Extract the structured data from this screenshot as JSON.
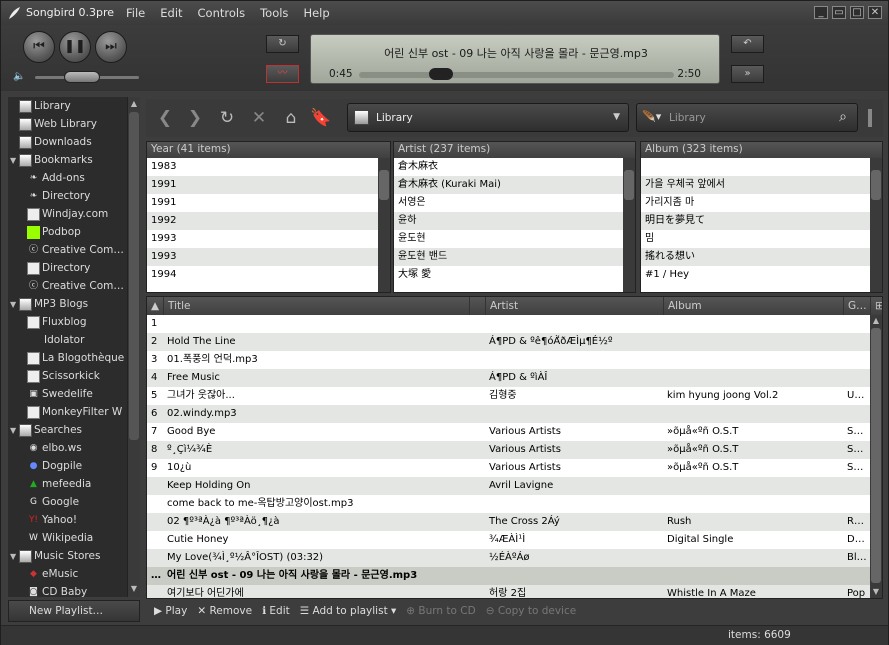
{
  "window": {
    "title": "Songbird 0.3pre",
    "controls": [
      "_",
      "▭",
      "□",
      "✕"
    ]
  },
  "menu": [
    "File",
    "Edit",
    "Controls",
    "Tools",
    "Help"
  ],
  "player": {
    "now_playing": "어린 신부 ost - 09 나는 아직 사랑을 몰라 - 문근영.mp3",
    "elapsed": "0:45",
    "total": "2:50",
    "progress": 0.26,
    "volume": 0.45,
    "prev_icon": "prev-icon",
    "pause_icon": "pause-icon",
    "next_icon": "next-icon",
    "repeat_icon": "repeat-icon",
    "shuffle_icon": "shuffle-icon",
    "back_icon": "back-icon",
    "forward_icon": "forward-icon"
  },
  "sidebar": {
    "items": [
      {
        "label": "Library",
        "level": 0,
        "icon": "library-icon",
        "twisty": ""
      },
      {
        "label": "Web Library",
        "level": 0,
        "icon": "library-icon",
        "twisty": ""
      },
      {
        "label": "Downloads",
        "level": 0,
        "icon": "download-icon",
        "twisty": ""
      },
      {
        "label": "Bookmarks",
        "level": 0,
        "icon": "bookmarks-icon",
        "twisty": "▼"
      },
      {
        "label": "Add-ons",
        "level": 1,
        "icon": "feather-icon",
        "twisty": ""
      },
      {
        "label": "Directory",
        "level": 1,
        "icon": "feather-icon",
        "twisty": ""
      },
      {
        "label": "Windjay.com",
        "level": 1,
        "icon": "page-icon",
        "twisty": ""
      },
      {
        "label": "Podbop",
        "level": 1,
        "icon": "podbop-icon",
        "twisty": ""
      },
      {
        "label": "Creative Com…",
        "level": 1,
        "icon": "cc-icon",
        "twisty": ""
      },
      {
        "label": "Directory",
        "level": 1,
        "icon": "page-icon",
        "twisty": ""
      },
      {
        "label": "Creative Com…",
        "level": 1,
        "icon": "cc-icon",
        "twisty": ""
      },
      {
        "label": "MP3 Blogs",
        "level": 0,
        "icon": "library-icon",
        "twisty": "▼"
      },
      {
        "label": "Fluxblog",
        "level": 1,
        "icon": "page-icon",
        "twisty": ""
      },
      {
        "label": "Idolator",
        "level": 1,
        "icon": "",
        "twisty": ""
      },
      {
        "label": "La Blogothèque",
        "level": 1,
        "icon": "page-icon",
        "twisty": ""
      },
      {
        "label": "Scissorkick",
        "level": 1,
        "icon": "page-icon",
        "twisty": ""
      },
      {
        "label": "Swedelife",
        "level": 1,
        "icon": "swedelife-icon",
        "twisty": ""
      },
      {
        "label": "MonkeyFilter W",
        "level": 1,
        "icon": "page-icon",
        "twisty": ""
      },
      {
        "label": "Searches",
        "level": 0,
        "icon": "library-icon",
        "twisty": "▼"
      },
      {
        "label": "elbo.ws",
        "level": 1,
        "icon": "elbows-icon",
        "twisty": ""
      },
      {
        "label": "Dogpile",
        "level": 1,
        "icon": "dogpile-icon",
        "twisty": ""
      },
      {
        "label": "mefeedia",
        "level": 1,
        "icon": "mefeedia-icon",
        "twisty": ""
      },
      {
        "label": "Google",
        "level": 1,
        "icon": "google-icon",
        "twisty": ""
      },
      {
        "label": "Yahoo!",
        "level": 1,
        "icon": "yahoo-icon",
        "twisty": ""
      },
      {
        "label": "Wikipedia",
        "level": 1,
        "icon": "wikipedia-icon",
        "twisty": ""
      },
      {
        "label": "Music Stores",
        "level": 0,
        "icon": "library-icon",
        "twisty": "▼"
      },
      {
        "label": "eMusic",
        "level": 1,
        "icon": "emusic-icon",
        "twisty": ""
      },
      {
        "label": "CD Baby",
        "level": 1,
        "icon": "cdbaby-icon",
        "twisty": ""
      }
    ],
    "new_playlist": "New Playlist…"
  },
  "toolbar": {
    "location": "Library",
    "search_placeholder": "Library"
  },
  "filters": [
    {
      "header": "Year (41 items)",
      "rows": [
        "",
        "1983",
        "1991",
        "1991",
        "1992",
        "1993",
        "1993",
        "1994"
      ]
    },
    {
      "header": "Artist (237 items)",
      "rows": [
        "",
        "倉木麻衣",
        "倉木麻衣 (Kuraki Mai)",
        "서영은",
        "윤하",
        "윤도현",
        "윤도현 밴드",
        "大塚 愛"
      ]
    },
    {
      "header": "Album (323 items)",
      "rows": [
        "",
        "",
        "가을 우체국 앞에서",
        "가리지좀 마",
        "明日を夢見て",
        "밈",
        "搖れる想い",
        "#1 / Hey"
      ]
    }
  ],
  "tracklist": {
    "columns": [
      "Title",
      "Artist",
      "Album",
      "G…"
    ],
    "rows": [
      {
        "num": "1",
        "title": "",
        "artist": "",
        "album": "",
        "genre": ""
      },
      {
        "num": "2",
        "title": "Hold The Line",
        "artist": "Á¶PD & ºê¶óÀ̾ðÆÌµ¶É½º",
        "album": "",
        "genre": ""
      },
      {
        "num": "3",
        "title": "01.폭풍의 언덕.mp3",
        "artist": "",
        "album": "",
        "genre": ""
      },
      {
        "num": "4",
        "title": "Free Music",
        "artist": "Á¶PD & ºìÀÎ",
        "album": "",
        "genre": ""
      },
      {
        "num": "5",
        "title": "그녀가 웃잖아...",
        "artist": "김형중",
        "album": "kim hyung joong Vol.2",
        "genre": "U…"
      },
      {
        "num": "6",
        "title": "02.windy.mp3",
        "artist": "",
        "album": "",
        "genre": ""
      },
      {
        "num": "7",
        "title": "Good Bye",
        "artist": "Various Artists",
        "album": "»õµå«ºñ O.S.T",
        "genre": "S…"
      },
      {
        "num": "8",
        "title": "º¸Çì¼¾È",
        "artist": "Various Artists",
        "album": "»õµå«ºñ O.S.T",
        "genre": "S…"
      },
      {
        "num": "9",
        "title": "10¿ù",
        "artist": "Various Artists",
        "album": "»õµå«ºñ O.S.T",
        "genre": "S…"
      },
      {
        "num": "",
        "title": "Keep Holding On",
        "artist": "Avril Lavigne",
        "album": "",
        "genre": ""
      },
      {
        "num": "",
        "title": "come back to me-옥탑방고양이ost.mp3",
        "artist": "",
        "album": "",
        "genre": ""
      },
      {
        "num": "",
        "title": "02 ¶º³ªÀ¿à ¶º³ªÀö¸¶¿à",
        "artist": "The Cross 2Áý",
        "album": "Rush",
        "genre": "R…"
      },
      {
        "num": "",
        "title": "Cutie Honey",
        "artist": "¾ÆÀÌ¹Ì",
        "album": "Digital Single",
        "genre": "D…"
      },
      {
        "num": "",
        "title": "My Love(¾Ì¸º½Â°ÎOST) (03:32)",
        "artist": "½ÉÀºÁø",
        "album": "",
        "genre": "Bl…"
      },
      {
        "num": "…",
        "title": "어린 신부 ost - 09 나는 아직 사랑을 몰라 - 문근영.mp3",
        "artist": "",
        "album": "",
        "genre": "",
        "playing": true
      },
      {
        "num": "",
        "title": "여기보다 어딘가에",
        "artist": "허랑 2집",
        "album": "Whistle In A Maze",
        "genre": "Pop"
      }
    ]
  },
  "actions": [
    {
      "label": "▶ Play",
      "enabled": true
    },
    {
      "label": "✕ Remove",
      "enabled": true
    },
    {
      "label": "ℹ Edit",
      "enabled": true
    },
    {
      "label": "☰ Add to playlist ▾",
      "enabled": true
    },
    {
      "label": "⊕ Burn to CD",
      "enabled": false
    },
    {
      "label": "⊖ Copy to device",
      "enabled": false
    }
  ],
  "status": {
    "items": "items: 6609"
  }
}
